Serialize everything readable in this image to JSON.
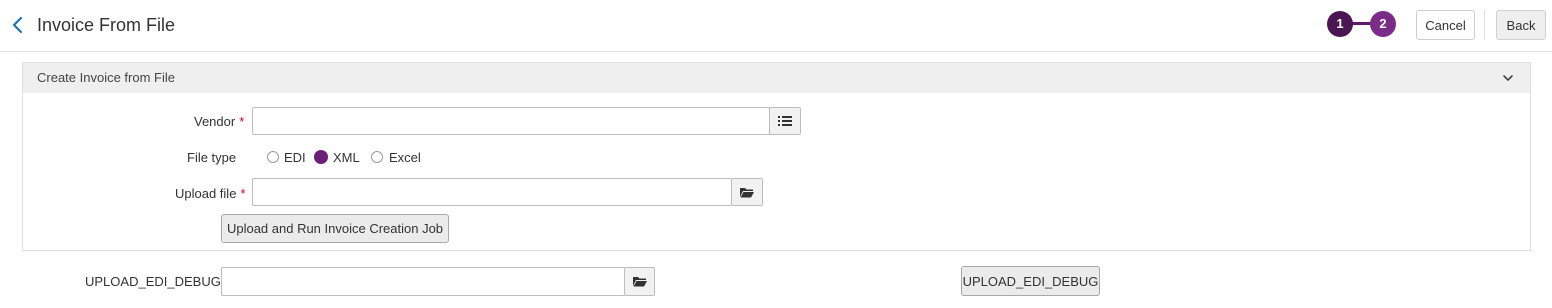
{
  "header": {
    "title": "Invoice From File",
    "back_icon": "chevron-left-icon",
    "steps": [
      "1",
      "2"
    ],
    "cancel_label": "Cancel",
    "back_label": "Back"
  },
  "section": {
    "title": "Create Invoice from File",
    "collapse_icon": "chevron-down-icon",
    "vendor_label": "Vendor",
    "vendor_value": "",
    "vendor_lookup_icon": "list-icon",
    "file_type_label": "File type",
    "file_type_options": [
      "EDI",
      "XML",
      "Excel"
    ],
    "file_type_selected": "XML",
    "upload_label": "Upload file",
    "upload_value": "",
    "upload_browse_icon": "folder-icon",
    "required_mark": "*",
    "run_button_label": "Upload and Run Invoice Creation Job"
  },
  "debug": {
    "label": "UPLOAD_EDI_DEBUG",
    "value": "",
    "browse_icon": "folder-icon",
    "button_label": "UPLOAD_EDI_DEBUG"
  },
  "colors": {
    "accent": "#6b1f77",
    "step1": "#4a1552",
    "step2": "#7a2c88",
    "required": "#d0021b",
    "back_arrow": "#1f72b5"
  }
}
